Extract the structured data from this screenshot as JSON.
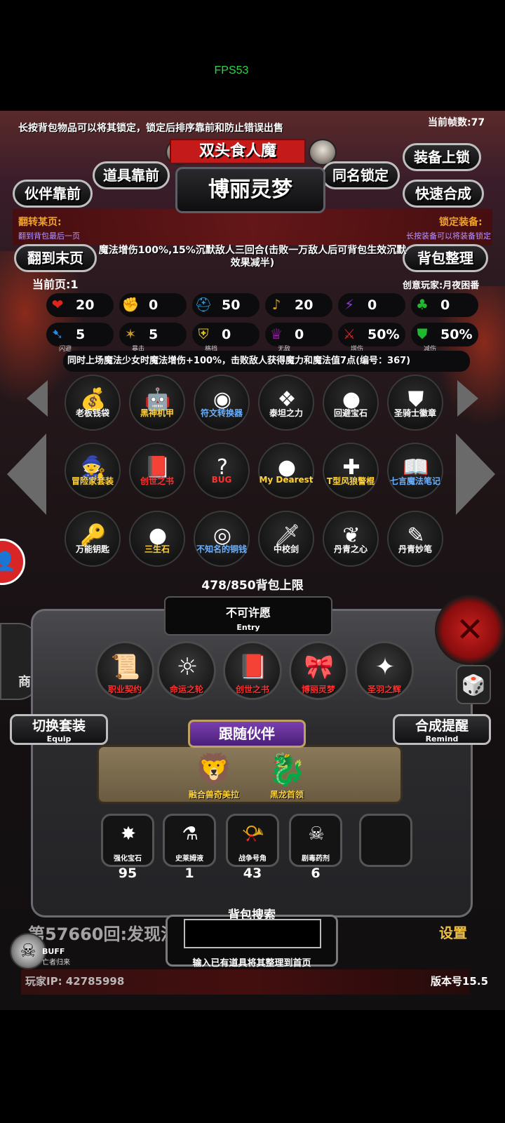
{
  "status": {
    "fps": "FPS53"
  },
  "header": {
    "hint": "长按背包物品可以将其锁定，锁定后排序靠前和防止错误出售",
    "frame_count": "当前帧数:77",
    "boss_name": "双头食人魔",
    "character": "博丽灵梦"
  },
  "buttons": {
    "item_front": "道具靠前",
    "partner_front": "伙伴靠前",
    "same_name_lock": "同名锁定",
    "equip_lock": "装备上锁",
    "quick_merge": "快速合成",
    "last_page": "翻到末页",
    "organize": "背包整理"
  },
  "notes": {
    "flip_title": "翻转某页:",
    "flip_sub": "翻到背包最后一页",
    "lock_title": "锁定装备:",
    "lock_sub": "长按装备可以将装备锁定"
  },
  "description": "魔法增伤100%,15%沉默敌人三回合(击败一万敌人后可背包生效沉默效果减半)",
  "page": {
    "current": "当前页:1",
    "creator": "创意玩家:月夜困番"
  },
  "stats": [
    {
      "icon": "heart-icon",
      "glyph": "❤",
      "color": "#e0241c",
      "value": "20",
      "label": ""
    },
    {
      "icon": "strength-icon",
      "glyph": "✊",
      "color": "#e6c21a",
      "value": "0",
      "label": ""
    },
    {
      "icon": "helmet-icon",
      "glyph": "⛑",
      "color": "#2a9ad8",
      "value": "50",
      "label": ""
    },
    {
      "icon": "lute-icon",
      "glyph": "♪",
      "color": "#c89a2a",
      "value": "20",
      "label": ""
    },
    {
      "icon": "lightning-icon",
      "glyph": "⚡",
      "color": "#8a3ae0",
      "value": "0",
      "label": ""
    },
    {
      "icon": "clover-icon",
      "glyph": "♣",
      "color": "#1fb82e",
      "value": "0",
      "label": ""
    },
    {
      "icon": "dodge-icon",
      "glyph": "➷",
      "color": "#2a8ae0",
      "value": "5",
      "label": "闪避"
    },
    {
      "icon": "crit-icon",
      "glyph": "✶",
      "color": "#c89a2a",
      "value": "5",
      "label": "暴击"
    },
    {
      "icon": "block-icon",
      "glyph": "⛨",
      "color": "#e0c21a",
      "value": "0",
      "label": "格挡"
    },
    {
      "icon": "invincible-icon",
      "glyph": "♕",
      "color": "#c82ad8",
      "value": "0",
      "label": "无敌"
    },
    {
      "icon": "damage-up-icon",
      "glyph": "⚔",
      "color": "#d82525",
      "value": "50%",
      "label": "增伤"
    },
    {
      "icon": "damage-reduce-icon",
      "glyph": "⛊",
      "color": "#1fb82e",
      "value": "50%",
      "label": "减伤"
    }
  ],
  "set_description": "同时上场魔法少女时魔法增伤+100%，击败敌人获得魔力和魔法值7点(编号：367)",
  "items": [
    {
      "name": "老板钱袋",
      "glyph": "💰",
      "color": "#ffffff"
    },
    {
      "name": "黑神机甲",
      "glyph": "🤖",
      "color": "#ffd23a"
    },
    {
      "name": "符文转换器",
      "glyph": "◉",
      "color": "#6ab0ff"
    },
    {
      "name": "泰坦之力",
      "glyph": "❖",
      "color": "#ffffff"
    },
    {
      "name": "回避宝石",
      "glyph": "●",
      "color": "#ffffff"
    },
    {
      "name": "圣骑士徽章",
      "glyph": "⛊",
      "color": "#ffffff"
    },
    {
      "name": "冒险家套装",
      "glyph": "🧙",
      "color": "#ffd23a"
    },
    {
      "name": "创世之书",
      "glyph": "📕",
      "color": "#ff3030"
    },
    {
      "name": "BUG",
      "glyph": "?",
      "color": "#ff3030"
    },
    {
      "name": "My Dearest",
      "glyph": "●",
      "color": "#ffd23a"
    },
    {
      "name": "T型风狼警棍",
      "glyph": "✚",
      "color": "#ffd23a"
    },
    {
      "name": "七言魔法笔记",
      "glyph": "📖",
      "color": "#6ab0ff"
    },
    {
      "name": "万能钥匙",
      "glyph": "🔑",
      "color": "#ffffff"
    },
    {
      "name": "三生石",
      "glyph": "●",
      "color": "#ffd23a"
    },
    {
      "name": "不知名的铜钱",
      "glyph": "◎",
      "color": "#6ab0ff"
    },
    {
      "name": "中校剑",
      "glyph": "🗡",
      "color": "#ffffff"
    },
    {
      "name": "丹青之心",
      "glyph": "❦",
      "color": "#ffffff"
    },
    {
      "name": "丹青妙笔",
      "glyph": "✎",
      "color": "#ffffff"
    }
  ],
  "capacity": "478/850背包上限",
  "wish": {
    "title": "不可许愿",
    "sub": "Entry"
  },
  "equipped": [
    {
      "name": "职业契约",
      "glyph": "📜"
    },
    {
      "name": "命运之轮",
      "glyph": "☼"
    },
    {
      "name": "创世之书",
      "glyph": "📕"
    },
    {
      "name": "博丽灵梦",
      "glyph": "🎀"
    },
    {
      "name": "圣羽之辉",
      "glyph": "✦"
    }
  ],
  "switch_equip": {
    "label": "切换套装",
    "sub": "Equip"
  },
  "merge_remind": {
    "label": "合成提醒",
    "sub": "Remind"
  },
  "follow": {
    "title": "跟随伙伴",
    "pets": [
      {
        "name": "融合兽奇美拉",
        "glyph": "🦁"
      },
      {
        "name": "黑龙首领",
        "glyph": "🐉"
      }
    ]
  },
  "consumables": [
    {
      "name": "强化宝石",
      "glyph": "✸",
      "count": "95"
    },
    {
      "name": "史莱姆液",
      "glyph": "⚗",
      "count": "1"
    },
    {
      "name": "战争号角",
      "glyph": "📯",
      "count": "43"
    },
    {
      "name": "剧毒药剂",
      "glyph": "☠",
      "count": "6"
    }
  ],
  "search": {
    "title": "背包搜索",
    "value": "",
    "hint": "输入已有道具将其整理到首页"
  },
  "footer": {
    "round": "第57660回:发现沉",
    "settings": "设置",
    "buff": "BUFF",
    "buff_sub": "亡者归来",
    "player_ip": "玩家IP: 42785998",
    "version": "版本号15.5",
    "shop": "商"
  }
}
